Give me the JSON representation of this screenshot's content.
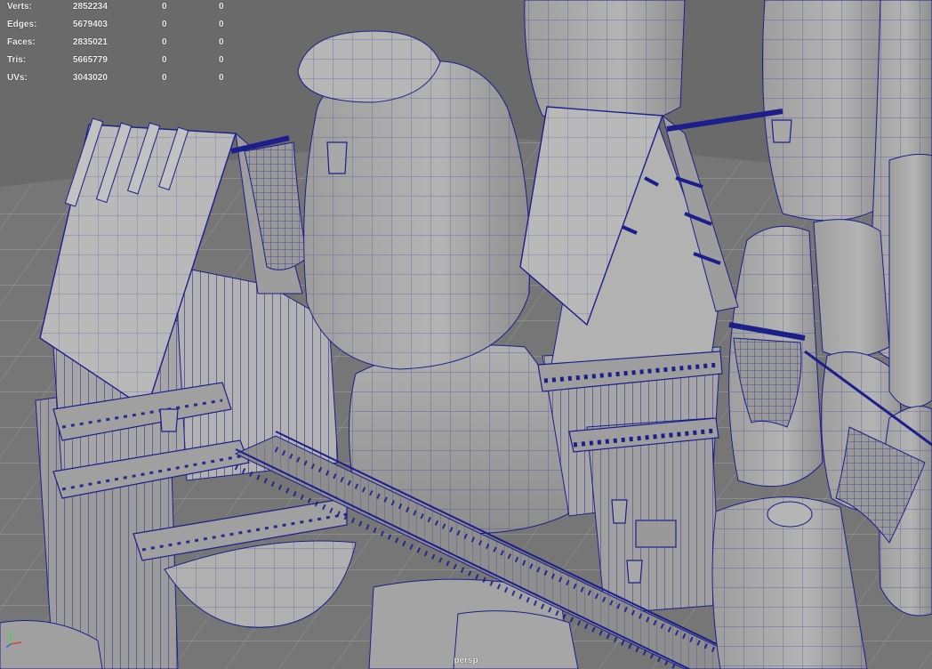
{
  "hud": {
    "rows": [
      {
        "label": "Verts:",
        "total": "2852234",
        "selected": "0",
        "uv": "0"
      },
      {
        "label": "Edges:",
        "total": "5679403",
        "selected": "0",
        "uv": "0"
      },
      {
        "label": "Faces:",
        "total": "2835021",
        "selected": "0",
        "uv": "0"
      },
      {
        "label": "Tris:",
        "total": "5665779",
        "selected": "0",
        "uv": "0"
      },
      {
        "label": "UVs:",
        "total": "3043020",
        "selected": "0",
        "uv": "0"
      }
    ]
  },
  "camera": {
    "label": "persp"
  },
  "colors": {
    "background": "#6a6a6a",
    "mesh": "#a9a9a9",
    "mesh_shadow": "#8c8c8c",
    "wireframe": "#1c1e8c",
    "hud_text": "#f2f2f2"
  }
}
